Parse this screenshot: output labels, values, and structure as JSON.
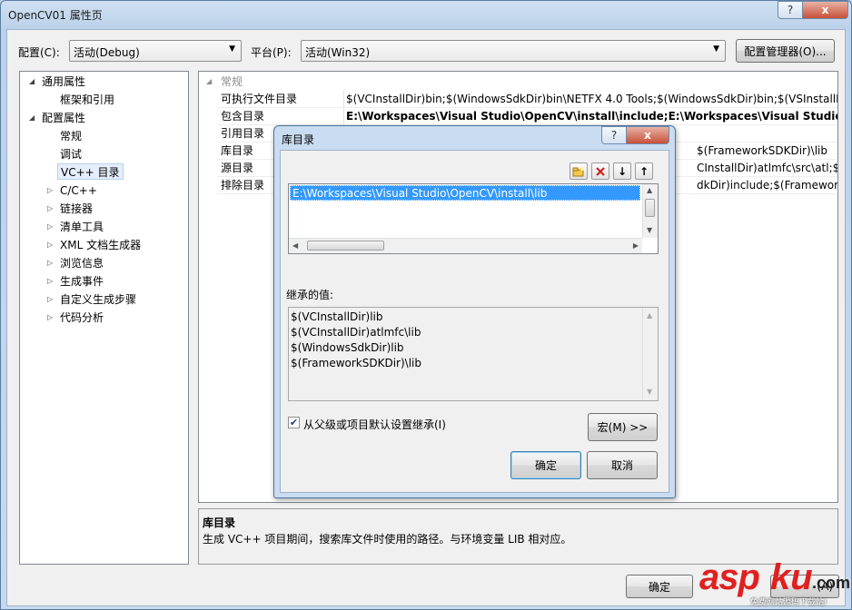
{
  "window": {
    "title": "OpenCV01 属性页",
    "help": "?",
    "close": "x"
  },
  "top_bar": {
    "config_label": "配置(C):",
    "config_value": "活动(Debug)",
    "platform_label": "平台(P):",
    "platform_value": "活动(Win32)",
    "manager_button": "配置管理器(O)..."
  },
  "tree": [
    {
      "label": "通用属性",
      "expanded": true
    },
    {
      "label": "框架和引用"
    },
    {
      "label": "配置属性",
      "expanded": true
    },
    {
      "label": "常规"
    },
    {
      "label": "调试"
    },
    {
      "label": "VC++ 目录",
      "selected": true
    },
    {
      "label": "C/C++"
    },
    {
      "label": "链接器"
    },
    {
      "label": "清单工具"
    },
    {
      "label": "XML 文档生成器"
    },
    {
      "label": "浏览信息"
    },
    {
      "label": "生成事件"
    },
    {
      "label": "自定义生成步骤"
    },
    {
      "label": "代码分析"
    }
  ],
  "grid": {
    "category": "常规",
    "rows": [
      {
        "name": "可执行文件目录",
        "value": "$(VCInstallDir)bin;$(WindowsSdkDir)bin\\NETFX 4.0 Tools;$(WindowsSdkDir)bin;$(VSInstallDir)"
      },
      {
        "name": "包含目录",
        "value": "E:\\Workspaces\\Visual Studio\\OpenCV\\install\\include;E:\\Workspaces\\Visual Studio\\Open"
      },
      {
        "name": "引用目录",
        "value": ""
      },
      {
        "name": "库目录",
        "value": "$(FrameworkSDKDir)\\lib"
      },
      {
        "name": "源目录",
        "value": "CInstallDir)atlmfc\\src\\atl;$(VCI"
      },
      {
        "name": "排除目录",
        "value": "dkDir)include;$(FrameworkSDK"
      }
    ]
  },
  "description": {
    "title": "库目录",
    "text": "生成 VC++ 项目期间，搜索库文件时使用的路径。与环境变量 LIB 相对应。"
  },
  "dialog": {
    "title": "库目录",
    "help": "?",
    "close": "x",
    "toolbar": {
      "new_line": "new-folder-icon",
      "delete": "delete-icon",
      "move_down": "↓",
      "move_up": "↑"
    },
    "entries": [
      "E:\\Workspaces\\Visual Studio\\OpenCV\\install\\lib"
    ],
    "inherited_label": "继承的值:",
    "inherited_values": [
      "$(VCInstallDir)lib",
      "$(VCInstallDir)atlmfc\\lib",
      "$(WindowsSdkDir)lib",
      "$(FrameworkSDKDir)\\lib"
    ],
    "inherit_checkbox_label": "从父级或项目默认设置继承(I)",
    "inherit_checked": true,
    "macro_button": "宏(M) >>",
    "ok": "确定",
    "cancel": "取消"
  },
  "bottom_buttons": {
    "ok": "确定",
    "apply_partial": "(A)"
  },
  "watermark": {
    "brand": "asp",
    "brand2": "ku",
    "dot": ".com",
    "subtitle": "免费网站源码下载站!"
  }
}
